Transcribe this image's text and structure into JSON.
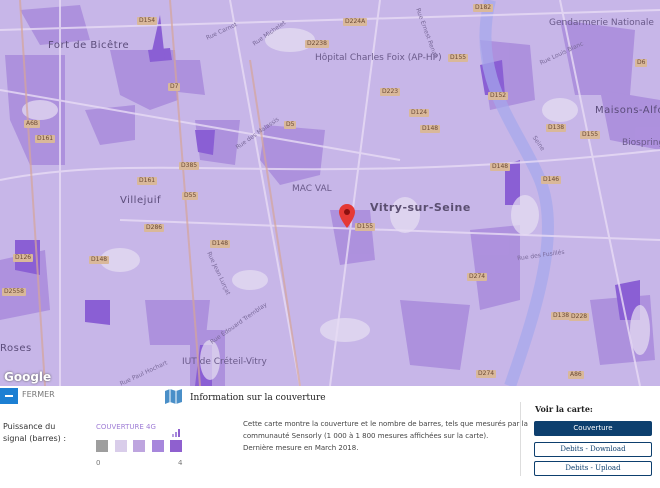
{
  "map": {
    "places": [
      "Fort de Bicêtre",
      "Hôpital Charles Foix (AP-HP)",
      "Gendarmerie Nationale",
      "MAC VAL",
      "Vitry-sur-Seine",
      "Villejuif",
      "Maisons-Alfort",
      "Biospringer",
      "IUT de Créteil-Vitry",
      "Roses"
    ],
    "roads": [
      "D154",
      "D2238",
      "D7",
      "A6B",
      "D161",
      "D5",
      "D385",
      "D161",
      "D55",
      "D182",
      "D224A",
      "D155",
      "D223",
      "D124",
      "D152",
      "D6",
      "D138",
      "D148",
      "D155",
      "D146",
      "D148",
      "D126",
      "D2558",
      "D286",
      "D148",
      "D148",
      "D274",
      "D138",
      "D228",
      "D274",
      "A86",
      "D155"
    ],
    "streets": [
      "Rue Carnot",
      "Rue Michelet",
      "Rue des Malassis",
      "Rue Ernest Renan",
      "Rue Louis Blanc",
      "Rue des Fusillés",
      "Rue Jean Lurçat",
      "Rue Édouard Tremblay",
      "Seine",
      "Rue Paul Hochart"
    ],
    "attribution": "Google"
  },
  "panel": {
    "close_label": "FERMER",
    "title": "Information sur la couverture",
    "signal_label_1": "Puissance du",
    "signal_label_2": "signal (barres) :",
    "legend_title": "COUVERTURE 4G",
    "legend_colors": [
      "#9e9e9e",
      "#d9cdea",
      "#bea5df",
      "#a787dc",
      "#8f60cf"
    ],
    "scale_min": "0",
    "scale_max": "4",
    "description": [
      "Cette carte montre la couverture et le nombre de barres, tels que mesurés par la",
      "communauté Sensorly (1 000 à 1 800 mesures affichées sur la carte).",
      "Dernière mesure en March 2018."
    ],
    "view_label": "Voir la carte:",
    "buttons": [
      "Couverture",
      "Debits - Download",
      "Debits - Upload"
    ],
    "accent": "#0d3f6e"
  }
}
